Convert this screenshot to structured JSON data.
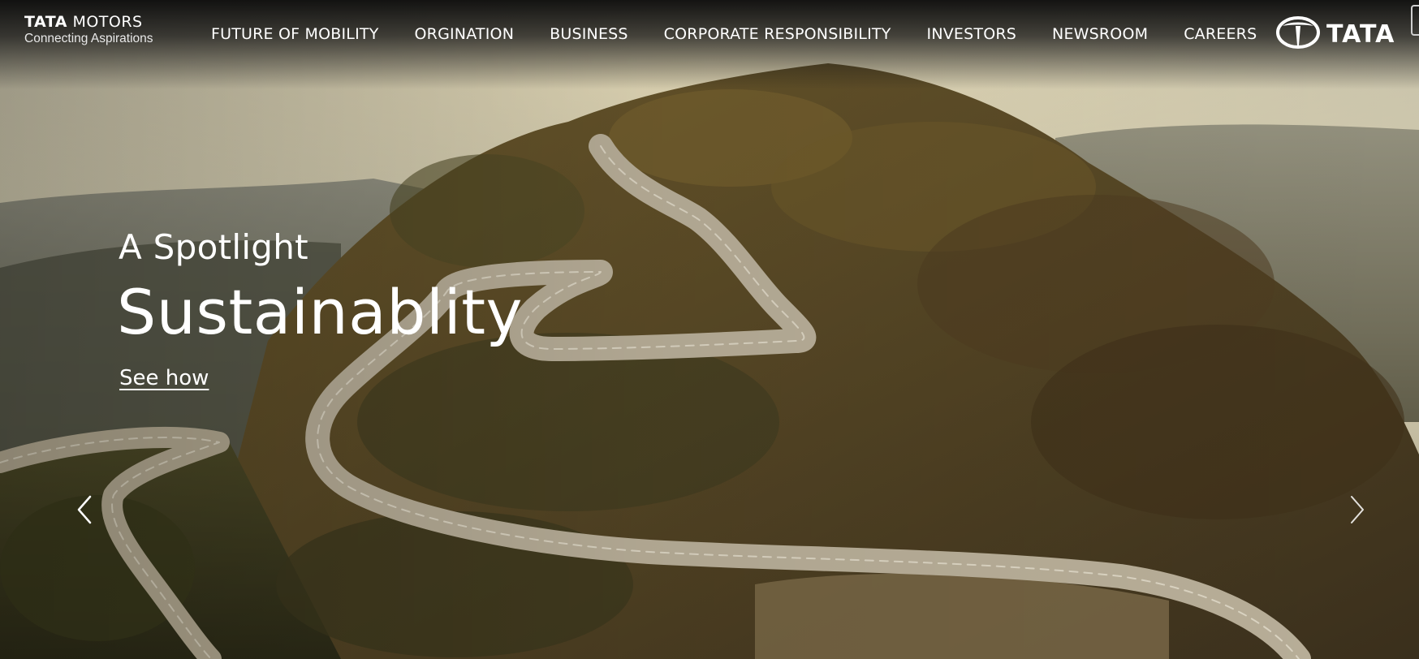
{
  "header": {
    "brand": {
      "name_bold": "TATA",
      "name_rest": " MOTORS",
      "tagline": "Connecting Aspirations"
    },
    "nav": [
      {
        "label": "FUTURE OF MOBILITY"
      },
      {
        "label": "ORGINATION"
      },
      {
        "label": "BUSINESS"
      },
      {
        "label": "CORPORATE RESPONSIBILITY"
      },
      {
        "label": "INVESTORS"
      },
      {
        "label": "NEWSROOM"
      },
      {
        "label": "CAREERS"
      }
    ],
    "group_logo": {
      "word": "TATA",
      "icon": "tata-emblem-icon"
    }
  },
  "hero": {
    "eyebrow": "A Spotlight",
    "headline": "Sustainablity",
    "cta": "See how",
    "prev_icon": "chevron-left-icon",
    "next_icon": "chevron-right-icon",
    "image": "aerial view of winding mountain road through autumn forest"
  },
  "colors": {
    "text": "#ffffff",
    "header_bg": "#141414"
  }
}
